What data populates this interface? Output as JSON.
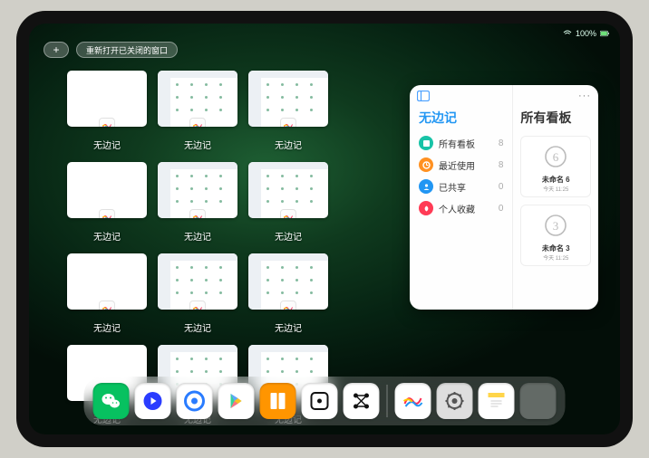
{
  "status": {
    "battery_text": "100%"
  },
  "topbar": {
    "plus_label": "+",
    "reopen_label": "重新打开已关闭的窗口"
  },
  "app_name": "无边记",
  "windows": [
    {
      "label": "无边记",
      "variant": "blank"
    },
    {
      "label": "无边记",
      "variant": "calendar1"
    },
    {
      "label": "无边记",
      "variant": "calendar2"
    },
    {
      "label": "无边记",
      "variant": "blank"
    },
    {
      "label": "无边记",
      "variant": "calendar1"
    },
    {
      "label": "无边记",
      "variant": "calendar2"
    },
    {
      "label": "无边记",
      "variant": "blank"
    },
    {
      "label": "无边记",
      "variant": "calendar1"
    },
    {
      "label": "无边记",
      "variant": "calendar2"
    },
    {
      "label": "无边记",
      "variant": "blank"
    },
    {
      "label": "无边记",
      "variant": "calendar1"
    },
    {
      "label": "无边记",
      "variant": "calendar2"
    }
  ],
  "panel": {
    "left_title": "无边记",
    "right_title": "所有看板",
    "rows": [
      {
        "label": "所有看板",
        "count": 8,
        "color": "#18c3a7"
      },
      {
        "label": "最近使用",
        "count": 8,
        "color": "#ff9122"
      },
      {
        "label": "已共享",
        "count": 0,
        "color": "#2196f3"
      },
      {
        "label": "个人收藏",
        "count": 0,
        "color": "#ff3b55"
      }
    ],
    "boards": [
      {
        "name": "未命名 6",
        "time": "今天 11:25",
        "digit": "6"
      },
      {
        "name": "未命名 3",
        "time": "今天 11:25",
        "digit": "3"
      }
    ]
  },
  "dock": [
    {
      "name": "wechat",
      "bg": "#07c160"
    },
    {
      "name": "tencent-video",
      "bg": "#ffffff"
    },
    {
      "name": "quark",
      "bg": "#ffffff"
    },
    {
      "name": "playstore",
      "bg": "#ffffff"
    },
    {
      "name": "books",
      "bg": "#ff9500"
    },
    {
      "name": "dice",
      "bg": "#ffffff"
    },
    {
      "name": "graph",
      "bg": "#ffffff"
    },
    {
      "name": "freeform",
      "bg": "#ffffff"
    },
    {
      "name": "settings",
      "bg": "#dedede"
    },
    {
      "name": "notes",
      "bg": "#ffffff"
    },
    {
      "name": "app-library",
      "bg": "#7fa9c9"
    }
  ]
}
